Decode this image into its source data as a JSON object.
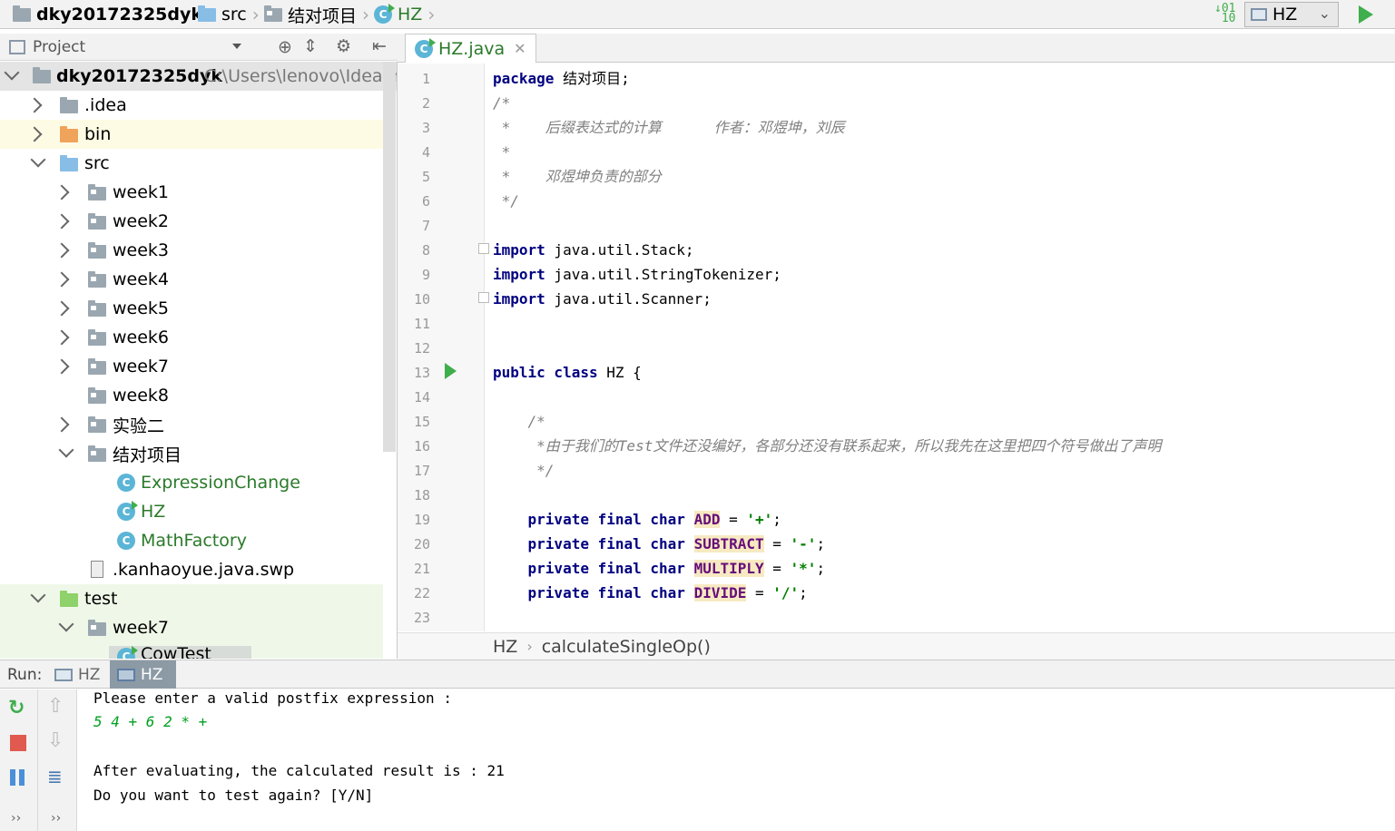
{
  "nav": {
    "project": "dky20172325dyk",
    "src": "src",
    "package": "结对项目",
    "file": "HZ",
    "run_config": "HZ"
  },
  "project_panel": {
    "title": "Project",
    "root": {
      "name": "dky20172325dyk",
      "path": "C:\\Users\\lenovo\\IdeaProj"
    },
    "items": [
      {
        "label": ".idea"
      },
      {
        "label": "bin"
      },
      {
        "label": "src"
      },
      {
        "label": "week1"
      },
      {
        "label": "week2"
      },
      {
        "label": "week3"
      },
      {
        "label": "week4"
      },
      {
        "label": "week5"
      },
      {
        "label": "week6"
      },
      {
        "label": "week7"
      },
      {
        "label": "week8"
      },
      {
        "label": "实验二"
      },
      {
        "label": "结对项目"
      },
      {
        "label": "ExpressionChange"
      },
      {
        "label": "HZ"
      },
      {
        "label": "MathFactory"
      },
      {
        "label": ".kanhaoyue.java.swp"
      },
      {
        "label": "test"
      },
      {
        "label": "week7"
      },
      {
        "label": "CowTest"
      }
    ]
  },
  "editor": {
    "tab": "HZ.java",
    "line_numbers": [
      "1",
      "2",
      "3",
      "4",
      "5",
      "6",
      "7",
      "8",
      "9",
      "10",
      "11",
      "12",
      "13",
      "14",
      "15",
      "16",
      "17",
      "18",
      "19",
      "20",
      "21",
      "22",
      "23"
    ],
    "breadcrumb": {
      "class": "HZ",
      "method": "calculateSingleOp()"
    },
    "code": {
      "l1_kw": "package",
      "l1_rest": " 结对项目;",
      "l2": "/*",
      "l3": " *    后缀表达式的计算      作者：邓煜坤，刘辰",
      "l4": " *",
      "l5": " *    邓煜坤负责的部分",
      "l6": " */",
      "import_kw": "import",
      "l8": " java.util.Stack;",
      "l9": " java.util.StringTokenizer;",
      "l10": " java.util.Scanner;",
      "l13_kw": "public class",
      "l13_rest": " HZ {",
      "l15": "    /*",
      "l16": "     *由于我们的Test文件还没编好，各部分还没有联系起来，所以我先在这里把四个符号做出了声明",
      "l17": "     */",
      "pf_kw": "    private final char",
      "f1": "ADD",
      "v1": "'+'",
      "f2": "SUBTRACT",
      "v2": "'-'",
      "f3": "MULTIPLY",
      "v3": "'*'",
      "f4": "DIVIDE",
      "v4": "'/'",
      "eq": " = ",
      "semi": ";"
    }
  },
  "run": {
    "label": "Run:",
    "tabs": [
      "HZ",
      "HZ"
    ],
    "output": [
      "Please enter a valid postfix expression :",
      "5 4 + 6 2 * +",
      "",
      "After evaluating, the calculated result is : 21",
      "Do you want to test again? [Y/N]"
    ]
  }
}
